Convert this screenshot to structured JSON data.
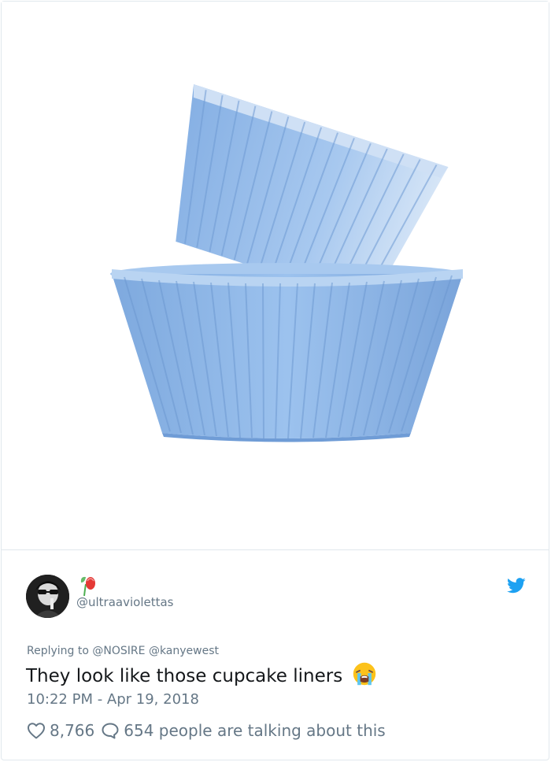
{
  "tweet": {
    "handle": "@ultraaviolettas",
    "replying_label": "Replying to",
    "reply_mentions": [
      "@NOSIRE",
      "@kanyewest"
    ],
    "text": "They look like those cupcake liners",
    "emoji": "loudly-crying-face",
    "timestamp": "10:22 PM - Apr 19, 2018",
    "likes": "8,766",
    "replies_summary": "654 people are talking about this"
  },
  "media": {
    "subject": "blue-cupcake-liners",
    "liner_color": "#8fb8e8"
  },
  "icons": {
    "brand": "twitter-bird-icon",
    "like": "heart-icon",
    "reply": "speech-bubble-icon",
    "name_decoration": "flower-icon"
  },
  "colors": {
    "text_primary": "#14171a",
    "text_secondary": "#657786",
    "twitter_blue": "#1da1f2",
    "border": "#e1e8ed"
  }
}
